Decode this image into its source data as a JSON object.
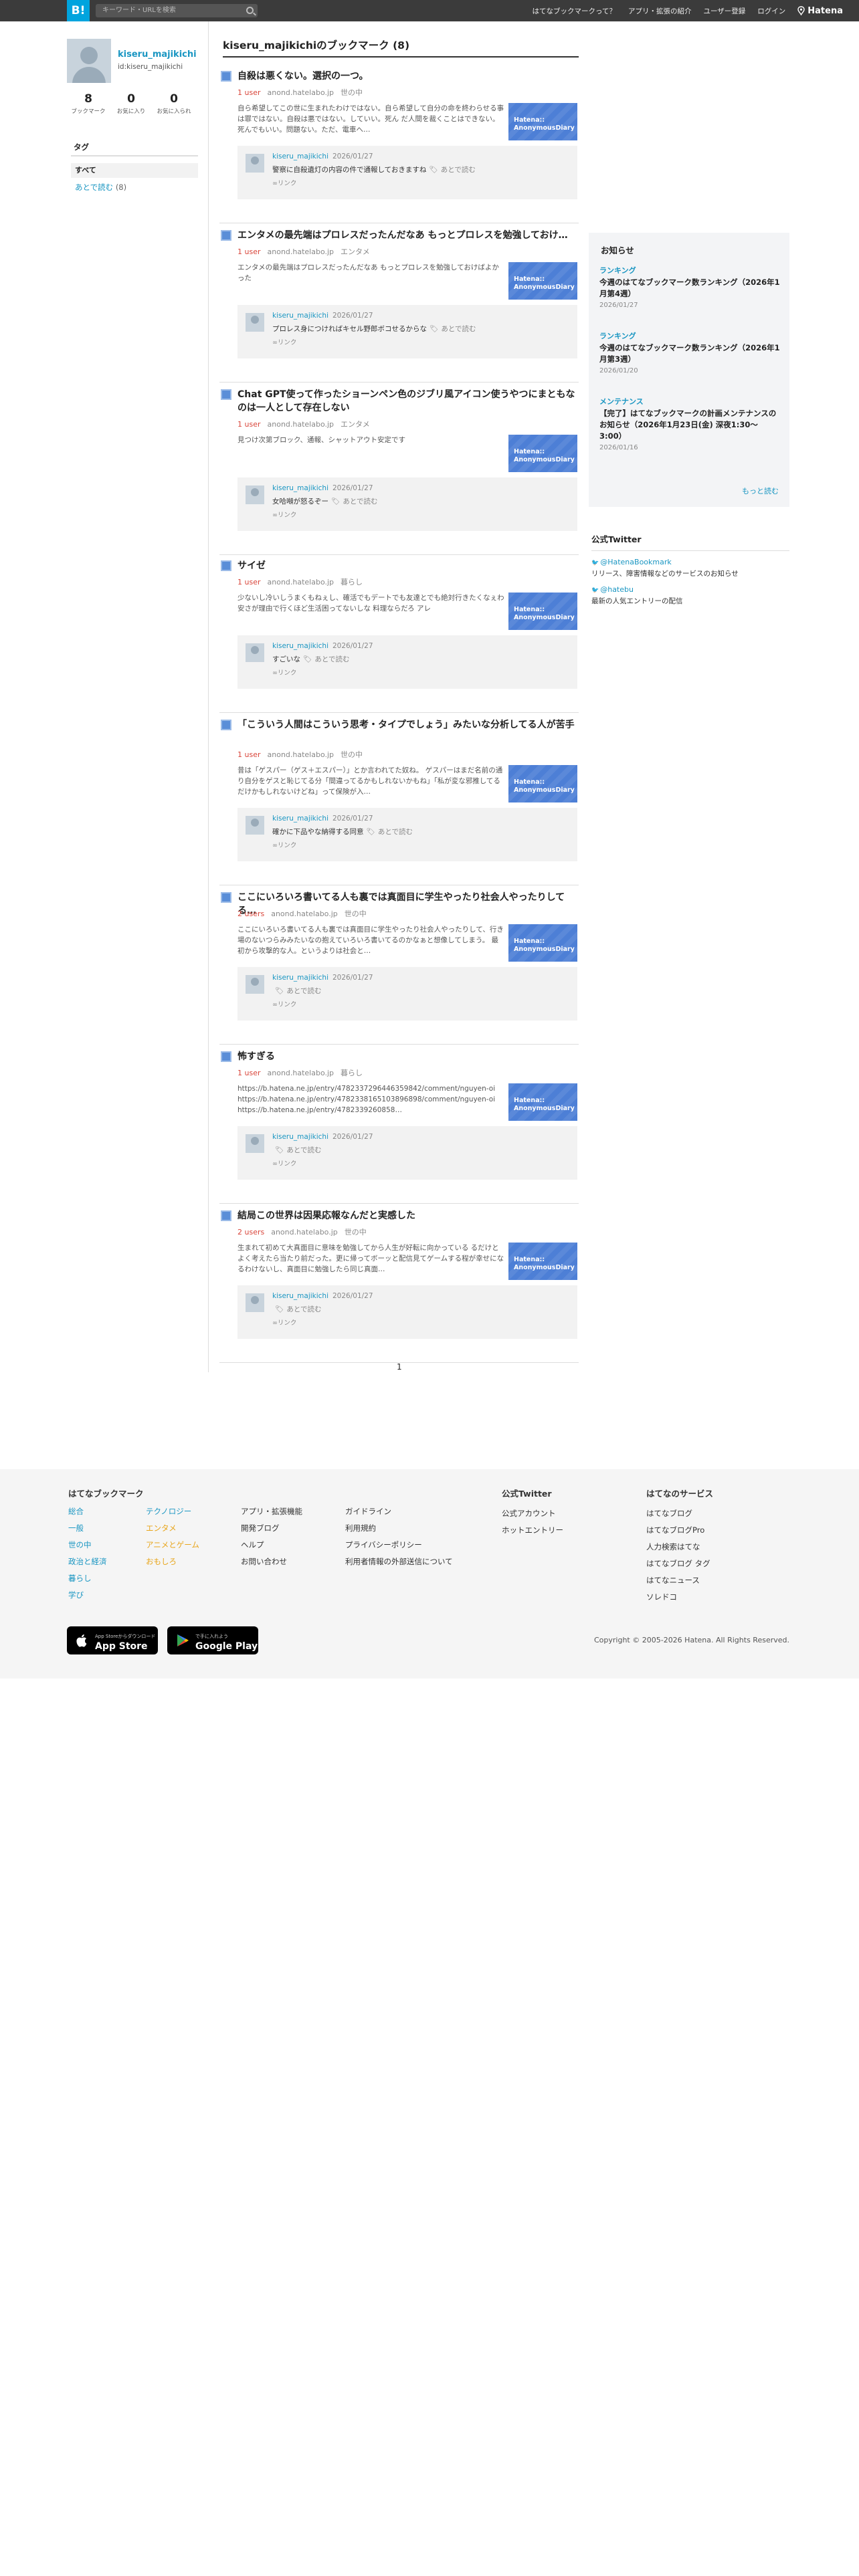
{
  "topbar": {
    "logo": "B!",
    "search_placeholder": "キーワード・URLを検索",
    "nav": [
      "はてなブックマークって？",
      "アプリ・拡張の紹介",
      "ユーザー登録",
      "ログイン"
    ],
    "brand": "Hatena"
  },
  "profile": {
    "name": "kiseru_majikichi",
    "id": "id:kiseru_majikichi",
    "stats": [
      {
        "n": "8",
        "label": "ブックマーク"
      },
      {
        "n": "0",
        "label": "お気に入り"
      },
      {
        "n": "0",
        "label": "お気に入られ"
      }
    ],
    "tag_header": "タグ",
    "tag_all": "すべて",
    "tag_read_later": "あとで読む",
    "tag_read_later_count": "(8)"
  },
  "main": {
    "heading": "kiseru_majikichiのブックマーク (8)",
    "entries": [
      {
        "title": "自殺は悪くない。選択の一つ。",
        "users": "1 user",
        "domain": "anond.hatelabo.jp",
        "category": "世の中",
        "desc": "自ら希望してこの世に生まれたわけではない。自ら希望して自分の命を終わらせる事は罪ではない。自殺は悪ではない。していい。死ん だ人間を裁くことはできない。死んでもいい。問題ない。ただ、電車へ…",
        "thumb": "Hatena:: AnonymousDiary",
        "comment_user": "kiseru_majikichi",
        "comment_date": "2026/01/27",
        "comment": "警察に自殺遺灯の内容の件で通報しておきますね",
        "tag": "あとで読む",
        "link": "リンク"
      },
      {
        "title": "エンタメの最先端はプロレスだったんだなあ もっとプロレスを勉強しておけ…",
        "users": "1 user",
        "domain": "anond.hatelabo.jp",
        "category": "エンタメ",
        "desc": "エンタメの最先端はプロレスだったんだなあ もっとプロレスを勉強しておけばよかった",
        "thumb": "Hatena:: AnonymousDiary",
        "comment_user": "kiseru_majikichi",
        "comment_date": "2026/01/27",
        "comment": "プロレス身につければキセル野郎ボコせるからな",
        "tag": "あとで読む",
        "link": "リンク"
      },
      {
        "title": "Chat GPT使って作ったショーンペン色のジブリ風アイコン使うやつにまともなのは一人として存在しない",
        "users": "1 user",
        "domain": "anond.hatelabo.jp",
        "category": "エンタメ",
        "desc": "見つけ次第ブロック、通報、シャットアウト安定です",
        "thumb": "Hatena:: AnonymousDiary",
        "comment_user": "kiseru_majikichi",
        "comment_date": "2026/01/27",
        "comment": "女哈噸が怒るぞー",
        "tag": "あとで読む",
        "link": "リンク"
      },
      {
        "title": "サイゼ",
        "users": "1 user",
        "domain": "anond.hatelabo.jp",
        "category": "暮らし",
        "desc": "少ないし冷いしうまくもねぇし、確活でもデートでも友達とでも絶対行きたくなぇわ 安さが理由で行くほど生活困ってないしな 料理ならだろ アレ",
        "thumb": "Hatena:: AnonymousDiary",
        "comment_user": "kiseru_majikichi",
        "comment_date": "2026/01/27",
        "comment": "すごいな",
        "tag": "あとで読む",
        "link": "リンク"
      },
      {
        "title": "「こういう人間はこういう思考・タイプでしょう」みたいな分析してる人が苦手",
        "users": "1 user",
        "domain": "anond.hatelabo.jp",
        "category": "世の中",
        "desc": "昔は「ゲスパー（ゲス＋エスパー）」とか言われてた奴ね。 ゲスパーはまだ名前の通り自分をゲスと恥じてる分「間違ってるかもしれないかもね」「私が変な邪推してるだけかもしれないけどね」って保険が入…",
        "thumb": "Hatena:: AnonymousDiary",
        "comment_user": "kiseru_majikichi",
        "comment_date": "2026/01/27",
        "comment": "確かに下品やな納得する同意",
        "tag": "あとで読む",
        "link": "リンク"
      },
      {
        "title": "ここにいろいろ書いてる人も裏では真面目に学生やったり社会人やったりしてる…",
        "users": "2 users",
        "domain": "anond.hatelabo.jp",
        "category": "世の中",
        "desc": "ここにいろいろ書いてる人も裏では真面目に学生やったり社会人やったりして、行き場のないつらみみたいなの抱えていろいろ書いてるのかなぁと想像してしまう。 最初から攻撃的な人。というよりは社会と…",
        "thumb": "Hatena:: AnonymousDiary",
        "comment_user": "kiseru_majikichi",
        "comment_date": "2026/01/27",
        "comment": "",
        "tag": "あとで読む",
        "link": "リンク"
      },
      {
        "title": "怖すぎる",
        "users": "1 user",
        "domain": "anond.hatelabo.jp",
        "category": "暮らし",
        "desc": "https://b.hatena.ne.jp/entry/4782337296446359842/comment/nguyen-oi https://b.hatena.ne.jp/entry/4782338165103896898/comment/nguyen-oi https://b.hatena.ne.jp/entry/4782339260858…",
        "thumb": "Hatena:: AnonymousDiary",
        "comment_user": "kiseru_majikichi",
        "comment_date": "2026/01/27",
        "comment": "",
        "tag": "あとで読む",
        "link": "リンク"
      },
      {
        "title": "結局この世界は因果応報なんだと実感した",
        "users": "2 users",
        "domain": "anond.hatelabo.jp",
        "category": "世の中",
        "desc": "生まれて初めて大真面目に意味を勉強してから人生が好転に向かっている るだけとよく考えたら当たり前だった。更に帰ってボーッと配信見てゲームする程が幸せになるわけないし、真面目に勉強したら同じ真面…",
        "thumb": "Hatena:: AnonymousDiary",
        "comment_user": "kiseru_majikichi",
        "comment_date": "2026/01/27",
        "comment": "",
        "tag": "あとで読む",
        "link": "リンク"
      }
    ],
    "page": "1"
  },
  "news": {
    "heading": "お知らせ",
    "items": [
      {
        "category": "ランキング",
        "title": "今週のはてなブックマーク数ランキング（2026年1月第4週）",
        "date": "2026/01/27"
      },
      {
        "category": "ランキング",
        "title": "今週のはてなブックマーク数ランキング（2026年1月第3週）",
        "date": "2026/01/20"
      },
      {
        "category": "メンテナンス",
        "title": "【完了】はてなブックマークの計画メンテナンスのお知らせ（2026年1月23日(金) 深夜1:30〜3:00）",
        "date": "2026/01/16"
      }
    ],
    "more": "もっと読む"
  },
  "twitter": {
    "heading": "公式Twitter",
    "accounts": [
      {
        "handle": "@HatenaBookmark",
        "desc": "リリース、障害情報などのサービスのお知らせ"
      },
      {
        "handle": "@hatebu",
        "desc": "最新の人気エントリーの配信"
      }
    ]
  },
  "footer": {
    "col1_title": "はてなブックマーク",
    "col1a": [
      "総合",
      "一般",
      "世の中",
      "政治と経済",
      "暮らし",
      "学び"
    ],
    "col1b": [
      "テクノロジー",
      "エンタメ",
      "アニメとゲーム",
      "おもしろ"
    ],
    "col1c": [
      "アプリ・拡張機能",
      "開発ブログ",
      "ヘルプ",
      "お問い合わせ"
    ],
    "col1d": [
      "ガイドライン",
      "利用規約",
      "プライバシーポリシー",
      "利用者情報の外部送信について"
    ],
    "col2_title": "公式Twitter",
    "col2": [
      "公式アカウント",
      "ホットエントリー"
    ],
    "col3_title": "はてなのサービス",
    "col3": [
      "はてなブログ",
      "はてなブログPro",
      "人力検索はてな",
      "はてなブログ タグ",
      "はてなニュース",
      "ソレドコ"
    ],
    "appstore_small": "App Storeからダウンロード",
    "appstore": "App Store",
    "googleplay_small": "で手に入れよう",
    "googleplay": "Google Play",
    "copyright": "Copyright © 2005-2026 Hatena. All Rights Reserved."
  }
}
